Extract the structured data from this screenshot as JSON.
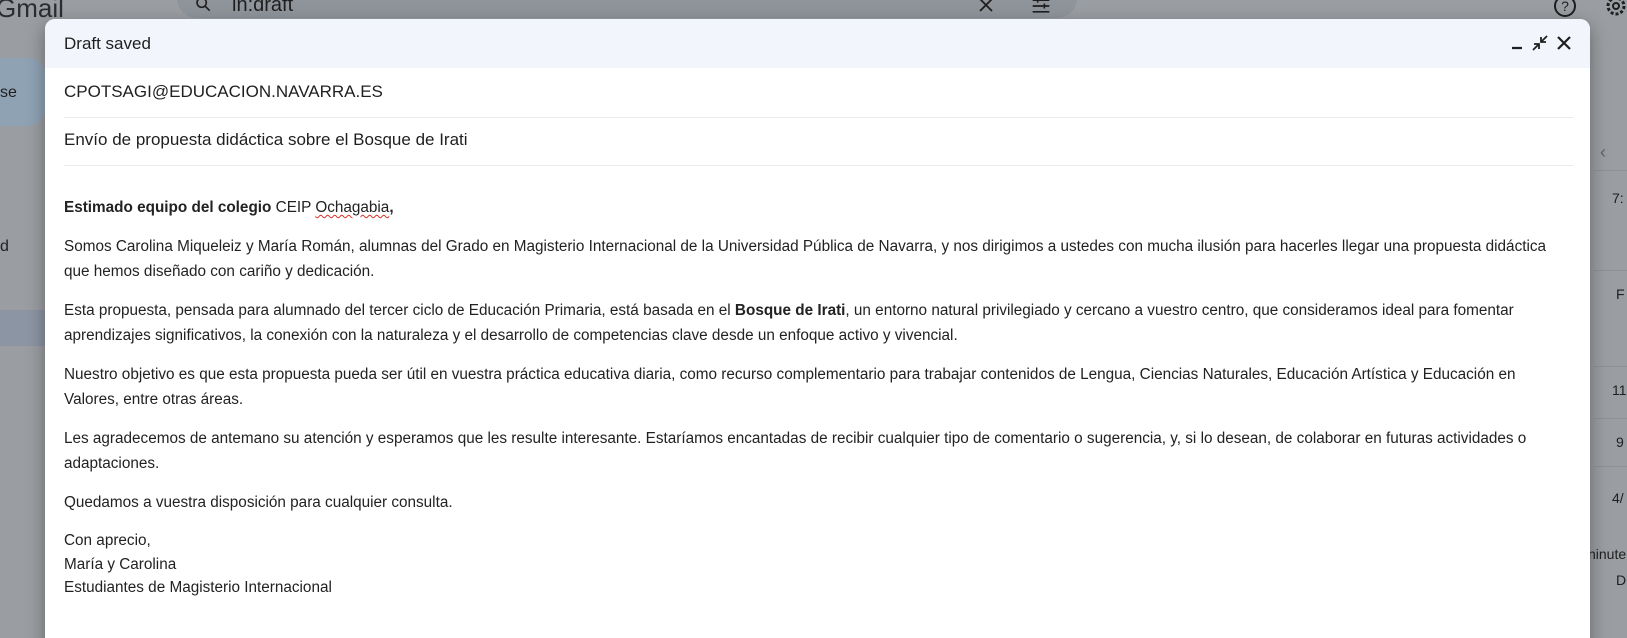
{
  "background": {
    "app_name": "Gmail",
    "search_query": "in:draft",
    "compose_label": "se",
    "sidebar_partial": "d",
    "right_snippets": [
      "7:",
      "F",
      "11",
      "9",
      "4/",
      "ninute",
      "D"
    ]
  },
  "compose": {
    "title": "Draft saved",
    "to": "CPOTSAGI@EDUCACION.NAVARRA.ES",
    "subject": "Envío de propuesta didáctica sobre el Bosque de Irati",
    "body": {
      "greeting_bold": "Estimado equipo del colegio",
      "greeting_school": " CEIP ",
      "greeting_school_name": "Ochagabia",
      "greeting_comma": ",",
      "p1": "Somos Carolina Miqueleiz y María Román, alumnas del Grado en Magisterio Internacional de la Universidad Pública de Navarra, y nos dirigimos a ustedes con mucha ilusión para hacerles llegar una propuesta didáctica que hemos diseñado con cariño y dedicación.",
      "p2_before": "Esta propuesta, pensada para alumnado del tercer ciclo de Educación Primaria, está basada en el ",
      "p2_bold": "Bosque de Irati",
      "p2_after": ", un entorno natural privilegiado y cercano a vuestro centro, que consideramos ideal para fomentar aprendizajes significativos, la conexión con la naturaleza y el desarrollo de competencias clave desde un enfoque activo y vivencial.",
      "p3": "Nuestro objetivo es que esta propuesta pueda ser útil en vuestra práctica educativa diaria, como recurso complementario para trabajar contenidos de Lengua, Ciencias Naturales, Educación Artística y Educación en Valores, entre otras áreas.",
      "p4": "Les agradecemos de antemano su atención y esperamos que les resulte interesante. Estaríamos encantadas de recibir cualquier tipo de comentario o sugerencia, y, si lo desean, de colaborar en futuras actividades o adaptaciones.",
      "p5": "Quedamos a vuestra disposición para cualquier consulta.",
      "sign_1": "Con aprecio,",
      "sign_2": "María y Carolina",
      "sign_3": "Estudiantes de Magisterio Internacional"
    },
    "icons": {
      "minimize": "minimize-icon",
      "fullscreen": "exit-fullscreen-icon",
      "close": "close-icon"
    }
  }
}
